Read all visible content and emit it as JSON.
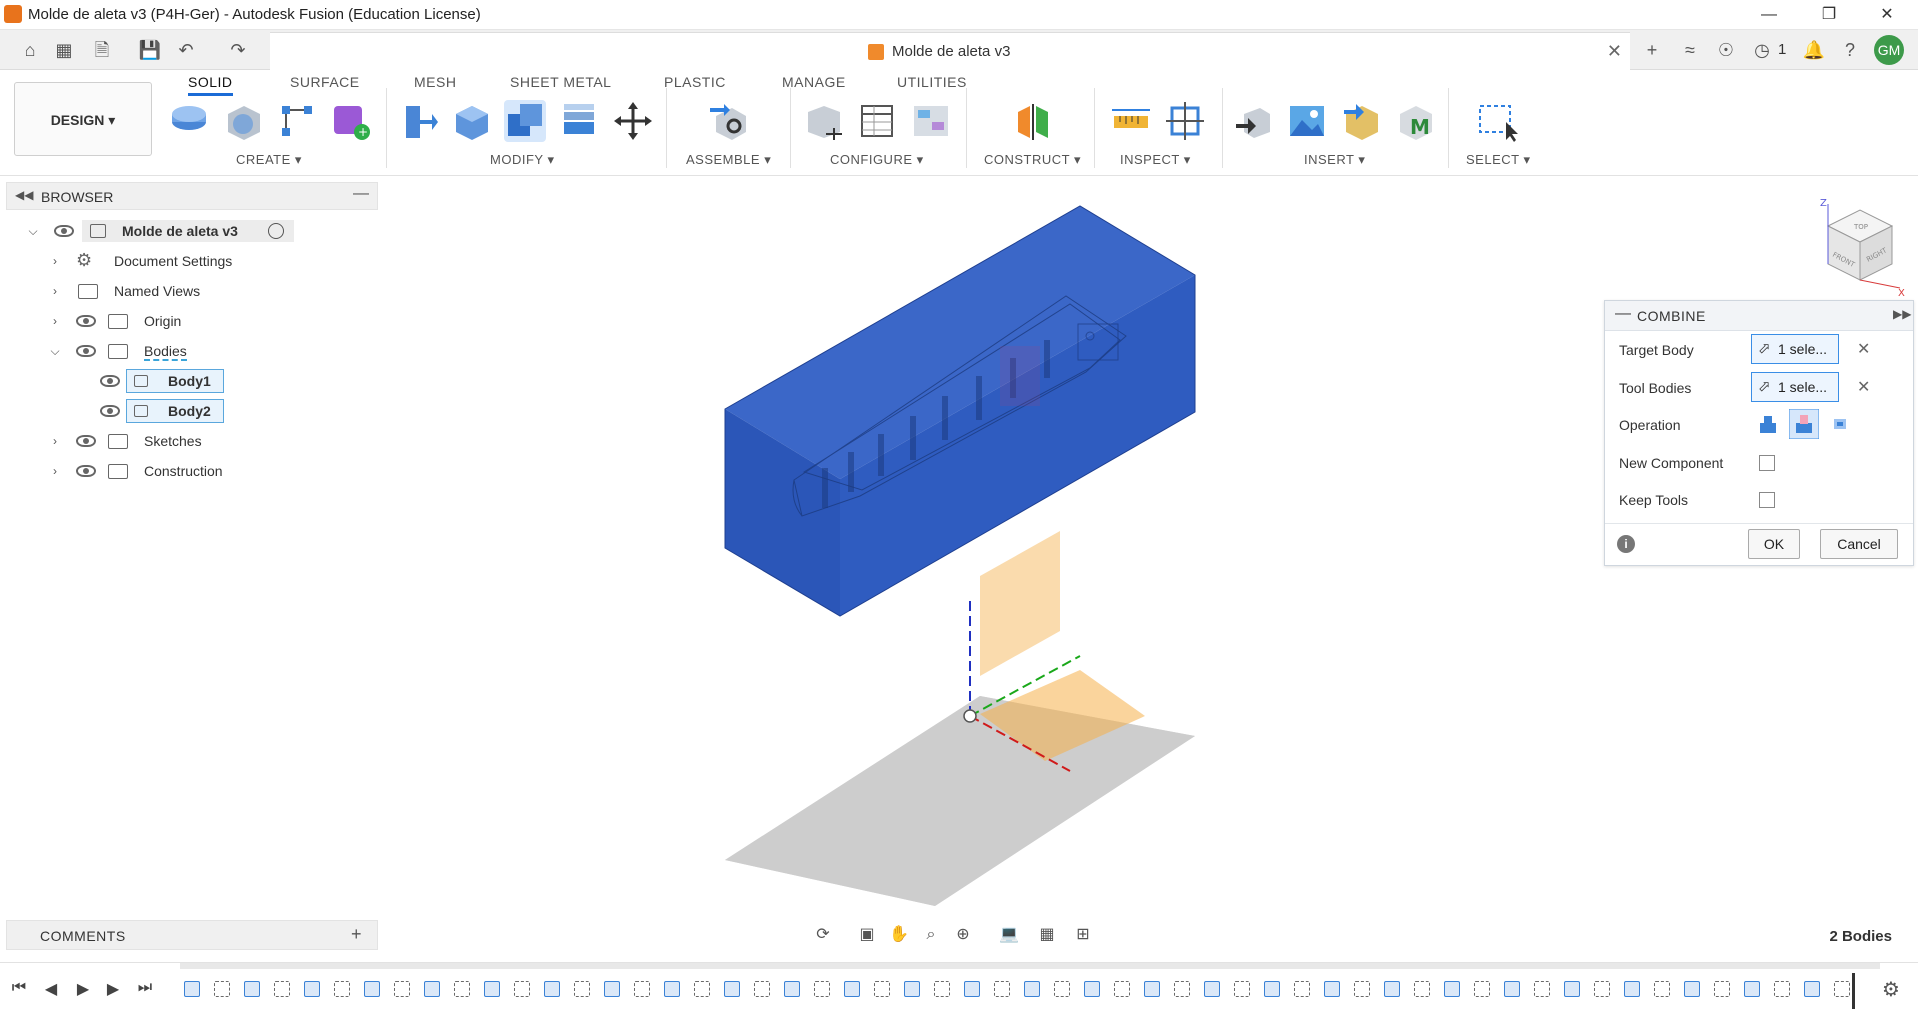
{
  "window": {
    "title": "Molde de aleta v3 (P4H-Ger) - Autodesk Fusion (Education License)"
  },
  "document_tab": {
    "title": "Molde de aleta v3"
  },
  "quick_access": {
    "job_count": "1",
    "user_initials": "GM"
  },
  "ribbon": {
    "workspace": "DESIGN",
    "tabs": [
      "SOLID",
      "SURFACE",
      "MESH",
      "SHEET METAL",
      "PLASTIC",
      "MANAGE",
      "UTILITIES"
    ],
    "active_tab": "SOLID",
    "groups": [
      "CREATE",
      "MODIFY",
      "ASSEMBLE",
      "CONFIGURE",
      "CONSTRUCT",
      "INSPECT",
      "INSERT",
      "SELECT"
    ]
  },
  "browser": {
    "title": "BROWSER",
    "root": "Molde de aleta v3",
    "items": [
      "Document Settings",
      "Named Views",
      "Origin",
      "Bodies",
      "Sketches",
      "Construction"
    ],
    "bodies": [
      "Body1",
      "Body2"
    ]
  },
  "comments": {
    "title": "COMMENTS"
  },
  "combine": {
    "title": "COMBINE",
    "target_body_label": "Target Body",
    "target_body_value": "1 sele...",
    "tool_bodies_label": "Tool Bodies",
    "tool_bodies_value": "1 sele...",
    "operation_label": "Operation",
    "operation_selected": "cut",
    "new_component_label": "New Component",
    "new_component_checked": false,
    "keep_tools_label": "Keep Tools",
    "keep_tools_checked": false,
    "ok_label": "OK",
    "cancel_label": "Cancel"
  },
  "status": {
    "bodies_count": "2 Bodies"
  },
  "viewcube": {
    "top": "TOP",
    "front": "FRONT",
    "right": "RIGHT",
    "axis_z": "Z",
    "axis_x": "X"
  },
  "colors": {
    "accent": "#1b6bd6",
    "body_blue": "#2b56b8",
    "plane_orange": "#f5b04a",
    "ground_grey": "#c9c9c9"
  }
}
